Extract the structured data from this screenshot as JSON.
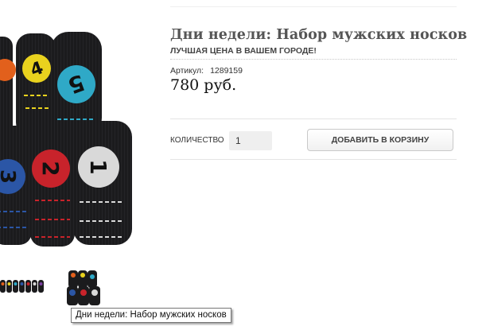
{
  "product": {
    "title": "Дни недели: Набор мужских носков",
    "promo": "ЛУЧШАЯ ЦЕНА В ВАШЕМ ГОРОДЕ!",
    "sku_label": "Артикул:",
    "sku_value": "1289159",
    "price": "780 руб.",
    "sock_numbers": [
      "4",
      "5",
      "3",
      "2",
      "1"
    ],
    "colors": {
      "sock_body": "#1b1b1d",
      "orange": "#e2601c",
      "yellow": "#e9d21e",
      "cyan": "#2fa9c7",
      "blue": "#2b56a6",
      "red": "#c8232b",
      "white": "#d9d9d9"
    }
  },
  "purchase": {
    "quantity_label": "КОЛИЧЕСТВО",
    "quantity_value": "1",
    "add_to_cart_label": "ДОБАВИТЬ В КОРЗИНУ"
  },
  "tooltip": {
    "text": "Дни недели: Набор мужских носков"
  }
}
